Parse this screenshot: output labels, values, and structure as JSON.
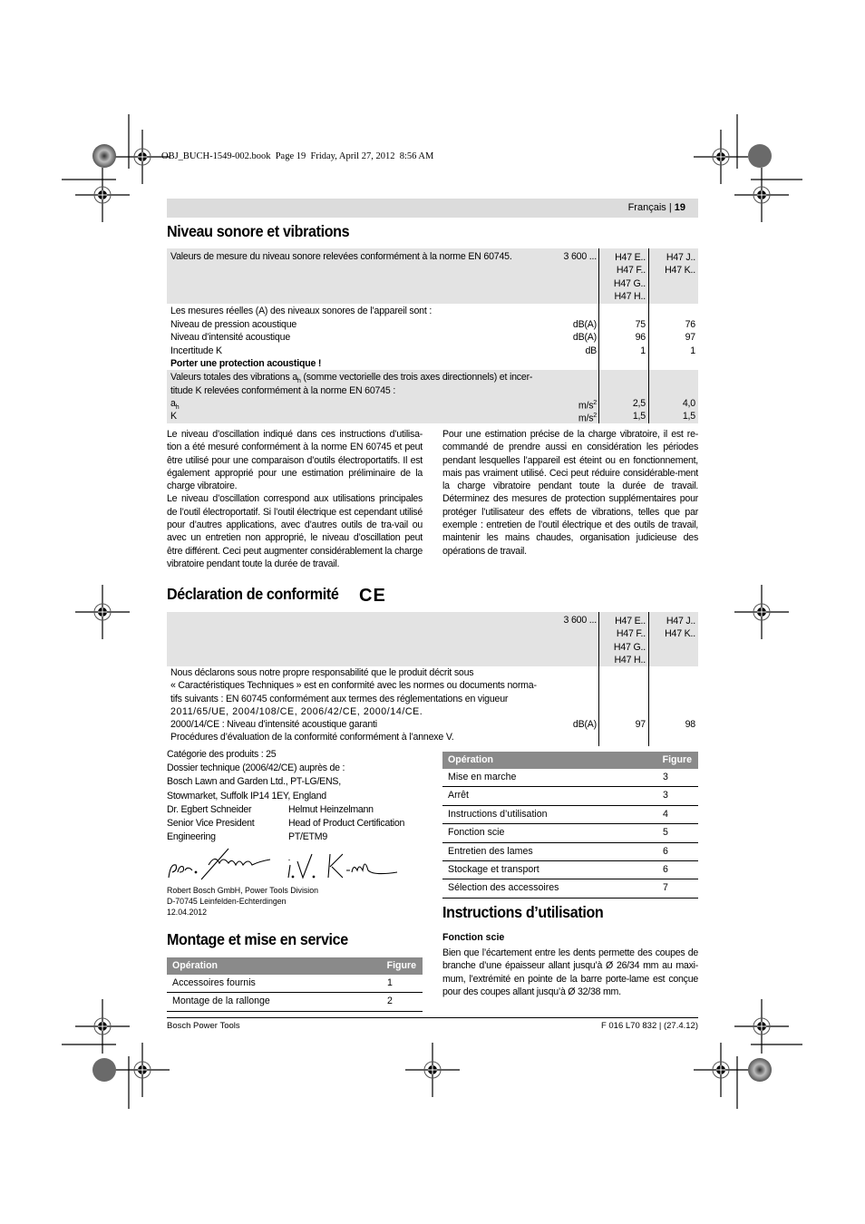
{
  "slug": "OBJ_BUCH-1549-002.book  Page 19  Friday, April 27, 2012  8:56 AM",
  "header": {
    "language": "Français",
    "separator": "|",
    "page_number": "19"
  },
  "noise": {
    "title": "Niveau sonore et vibrations",
    "table": {
      "intro": "Valeurs de mesure du niveau sonore relevées conformément à la norme EN 60745.",
      "model_prefix": "3 600 ...",
      "col1_models": [
        "H47 E..",
        "H47 F..",
        "H47 G..",
        "H47 H.."
      ],
      "col2_models": [
        "H47 J..",
        "H47 K.."
      ],
      "measure_intro": "Les mesures réelles (A) des niveaux sonores de l’appareil sont :",
      "rows": [
        {
          "label": "Niveau de pression acoustique",
          "unit": "dB(A)",
          "v1": "75",
          "v2": "76"
        },
        {
          "label": "Niveau d’intensité acoustique",
          "unit": "dB(A)",
          "v1": "96",
          "v2": "97"
        },
        {
          "label": "Incertitude K",
          "unit": "dB",
          "v1": "1",
          "v2": "1"
        }
      ],
      "warning": "Porter une protection acoustique !",
      "vib_intro_1a": "Valeurs totales des vibrations a",
      "vib_intro_sub": "h",
      "vib_intro_1b": " (somme vectorielle des trois axes directionnels) et incer-",
      "vib_intro_2": "titude K relevées conformément à la norme EN 60745 :",
      "vib_rows": [
        {
          "label": "a",
          "label_sub": "h",
          "unit": "m/s",
          "unit_sup": "2",
          "v1": "2,5",
          "v2": "4,0"
        },
        {
          "label": "K",
          "label_sub": "",
          "unit": "m/s",
          "unit_sup": "2",
          "v1": "1,5",
          "v2": "1,5"
        }
      ]
    },
    "para_left": "Le niveau d’oscillation indiqué dans ces instructions d’utilisa-tion a été mesuré conformément à la norme EN 60745 et peut être utilisé pour une comparaison d’outils électroportatifs. Il est également approprié pour une estimation préliminaire de la charge vibratoire.",
    "para_left_2": "Le niveau d’oscillation correspond aux utilisations principales de l’outil électroportatif. Si l’outil électrique est cependant utilisé pour d’autres applications, avec d’autres outils de tra-vail ou avec un entretien non approprié, le niveau d’oscillation peut être différent. Ceci peut augmenter considérablement la charge vibratoire pendant toute la durée de travail.",
    "para_right": "Pour une estimation précise de la charge vibratoire, il est re-commandé de prendre aussi en considération les périodes pendant lesquelles l’appareil est éteint ou en fonctionnement, mais pas vraiment utilisé. Ceci peut réduire considérable-ment la charge vibratoire pendant toute la durée de travail. Déterminez des mesures de protection supplémentaires pour protéger l’utilisateur des effets de vibrations, telles que par exemple : entretien de l’outil électrique et des outils de travail, maintenir les mains chaudes, organisation judicieuse des opérations de travail."
  },
  "conformity": {
    "title": "Déclaration de conformité",
    "ce_mark": "CE",
    "table": {
      "model_prefix": "3 600 ...",
      "col1_models": [
        "H47 E..",
        "H47 F..",
        "H47 G..",
        "H47 H.."
      ],
      "col2_models": [
        "H47 J..",
        "H47 K.."
      ],
      "lines": [
        "Nous déclarons sous notre propre responsabilité que le produit décrit sous",
        "« Caractéristiques Techniques » est en conformité avec les normes ou documents norma-",
        "tifs suivants : EN 60745 conformément aux termes des réglementations en vigueur",
        "2011/65/UE, 2004/108/CE, 2006/42/CE, 2000/14/CE.",
        "2000/14/CE : Niveau d’intensité acoustique garanti",
        "Procédures d’évaluation de la conformité conformément à l’annexe V."
      ],
      "guaranteed_unit": "dB(A)",
      "guaranteed_v1": "97",
      "guaranteed_v2": "98"
    },
    "category": "Catégorie des produits : 25",
    "dossier": [
      "Dossier technique (2006/42/CE) auprès de :",
      "Bosch Lawn and Garden Ltd., PT-LG/ENS,",
      "Stowmarket, Suffolk IP14 1EY, England"
    ],
    "signer1": [
      "Dr. Egbert Schneider",
      "Senior Vice President",
      "Engineering"
    ],
    "signer2": [
      "Helmut Heinzelmann",
      "Head of Product Certification",
      "PT/ETM9"
    ],
    "signature1_text": "ppa. Schneider",
    "signature2_text": "i.V. Heinzelmann",
    "company": [
      "Robert Bosch GmbH, Power Tools Division",
      "D-70745 Leinfelden-Echterdingen",
      "12.04.2012"
    ]
  },
  "mounting": {
    "title": "Montage et mise en service",
    "header": {
      "operation": "Opération",
      "figure": "Figure"
    },
    "rows": [
      {
        "operation": "Accessoires fournis",
        "figure": "1"
      },
      {
        "operation": "Montage de la rallonge",
        "figure": "2"
      }
    ]
  },
  "operation_table": {
    "header": {
      "operation": "Opération",
      "figure": "Figure"
    },
    "rows": [
      {
        "operation": "Mise en marche",
        "figure": "3"
      },
      {
        "operation": "Arrêt",
        "figure": "3"
      },
      {
        "operation": "Instructions d’utilisation",
        "figure": "4"
      },
      {
        "operation": "Fonction scie",
        "figure": "5"
      },
      {
        "operation": "Entretien des lames",
        "figure": "6"
      },
      {
        "operation": "Stockage et transport",
        "figure": "6"
      },
      {
        "operation": "Sélection des accessoires",
        "figure": "7"
      }
    ]
  },
  "instructions": {
    "title": "Instructions d’utilisation",
    "subtitle": "Fonction scie",
    "text": "Bien que l’écartement entre les dents permette des coupes de branche d’une épaisseur allant jusqu’à Ø 26/34 mm au maxi-mum, l’extrémité en pointe de la barre porte-lame est conçue pour des coupes allant jusqu’à Ø 32/38 mm."
  },
  "footer": {
    "left": "Bosch Power Tools",
    "right": "F 016 L70 832 | (27.4.12)"
  },
  "colors": {
    "header_bar": "#dcdcdc",
    "table_gray": "#e3e3e3",
    "table_header": "#8a8a8a"
  }
}
